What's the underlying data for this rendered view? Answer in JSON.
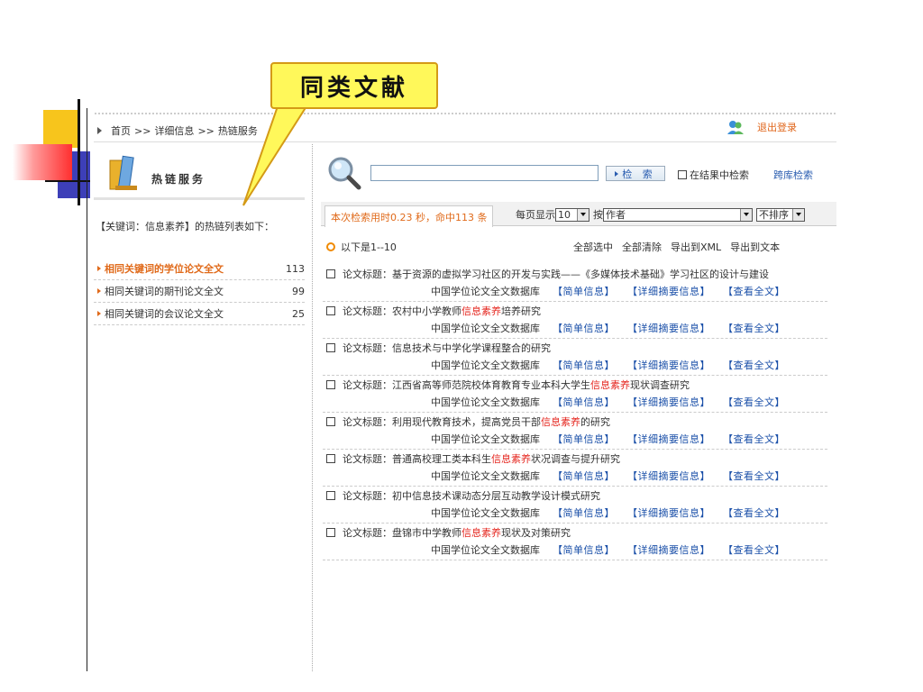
{
  "callout": {
    "text": "同类文献"
  },
  "breadcrumb": [
    "首页",
    ">>",
    "详细信息",
    ">>",
    "热链服务"
  ],
  "header": {
    "logout_label": "退出登录"
  },
  "sidebar": {
    "title": "热链服务",
    "keyword_note": "【关键词：信息素养】的热链列表如下：",
    "items": [
      {
        "label": "相同关键词的学位论文全文",
        "count": "113",
        "active": true
      },
      {
        "label": "相同关键词的期刊论文全文",
        "count": "99",
        "active": false
      },
      {
        "label": "相同关键词的会议论文全文",
        "count": "25",
        "active": false
      }
    ]
  },
  "search": {
    "value": "",
    "button_label": "检 索",
    "in_result_label": "在结果中检索",
    "cross_search_label": "跨库检索"
  },
  "status": {
    "text": "本次检索用时0.23 秒，命中113 条"
  },
  "options": {
    "per_page_label": "每页显示",
    "per_page_value": "10",
    "sort_by_label": "按",
    "sort_field_value": "作者",
    "sort_order_value": "不排序"
  },
  "list": {
    "range_label": "以下是1--10",
    "select_all": "全部选中",
    "clear_all": "全部清除",
    "export_xml": "导出到XML",
    "export_text": "导出到文本"
  },
  "result_labels": {
    "title_prefix": "论文标题：",
    "database": "中国学位论文全文数据库",
    "brief": "【简单信息】",
    "detail": "【详细摘要信息】",
    "fulltext": "【查看全文】"
  },
  "results": [
    {
      "before": "基于资源的虚拟学习社区的开发与实践——《多媒体技术基础》学习社区的设计与建设",
      "highlight": "",
      "after": ""
    },
    {
      "before": "农村中小学教师",
      "highlight": "信息素养",
      "after": "培养研究"
    },
    {
      "before": "信息技术与中学化学课程整合的研究",
      "highlight": "",
      "after": ""
    },
    {
      "before": "江西省高等师范院校体育教育专业本科大学生",
      "highlight": "信息素养",
      "after": "现状调查研究"
    },
    {
      "before": "利用现代教育技术，提高党员干部",
      "highlight": "信息素养",
      "after": "的研究"
    },
    {
      "before": "普通高校理工类本科生",
      "highlight": "信息素养",
      "after": "状况调查与提升研究"
    },
    {
      "before": "初中信息技术课动态分层互动教学设计模式研究",
      "highlight": "",
      "after": ""
    },
    {
      "before": "盘锦市中学教师",
      "highlight": "信息素养",
      "after": "现状及对策研究"
    }
  ],
  "colors": {
    "accent_orange": "#e06a1a",
    "link_blue": "#1a4fa8",
    "highlight_red": "#e5251e",
    "callout_yellow": "#fff85a"
  },
  "icons": [
    "search-magnifier-icon",
    "books-icon",
    "users-icon",
    "triangle-bullet-icon"
  ]
}
